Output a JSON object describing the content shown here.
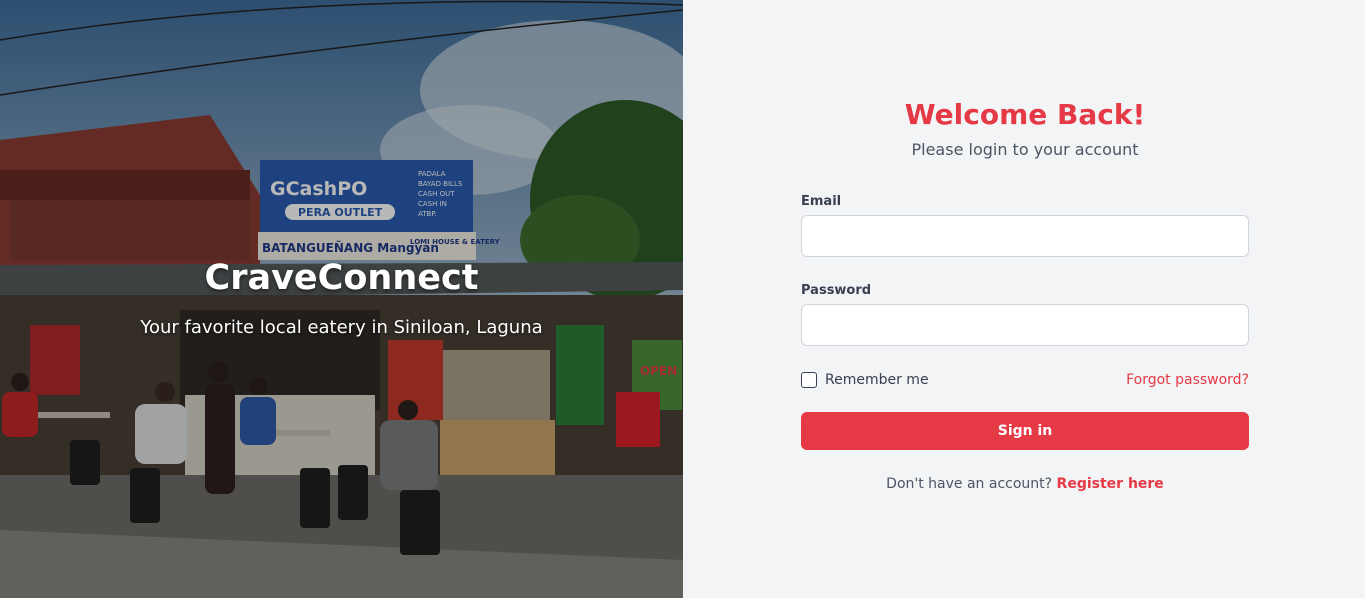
{
  "hero": {
    "brand": "CraveConnect",
    "tagline": "Your favorite local eatery in Siniloan, Laguna",
    "photo": {
      "sign_gcash": "GCashPO",
      "sign_pera_outlet": "PERA OUTLET",
      "sign_services": [
        "PADALA",
        "BAYAD BILLS",
        "CASH OUT",
        "CASH IN",
        "ATBP."
      ],
      "sign_eatery_name": "BATANGUEÑANG Mangyan",
      "sign_eatery_type": "LOMI HOUSE & EATERY",
      "sign_open": "OPEN"
    }
  },
  "login": {
    "title": "Welcome Back!",
    "subtitle": "Please login to your account",
    "email_label": "Email",
    "email_value": "",
    "password_label": "Password",
    "password_value": "",
    "remember_label": "Remember me",
    "remember_checked": false,
    "forgot_label": "Forgot password?",
    "signin_label": "Sign in",
    "register_prompt": "Don't have an account?",
    "register_link": "Register here"
  },
  "colors": {
    "accent": "#e53945",
    "panel_bg": "#f3f4f6"
  }
}
